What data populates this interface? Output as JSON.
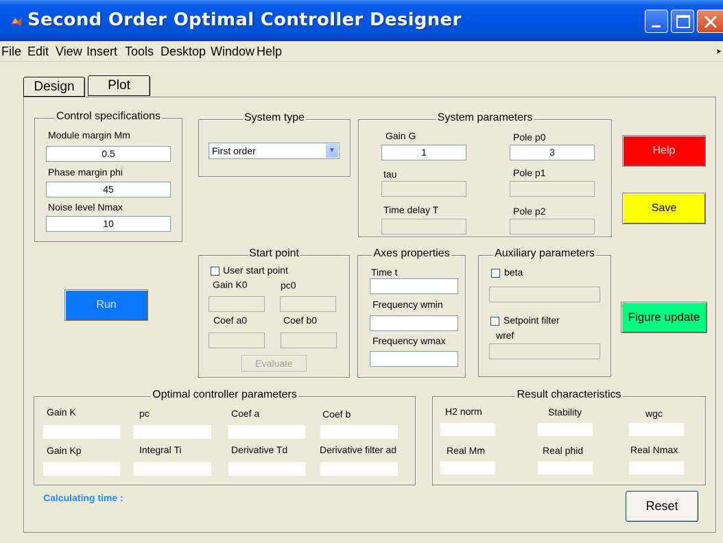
{
  "window": {
    "title": "Second Order Optimal Controller Designer"
  },
  "menu": [
    "File",
    "Edit",
    "View",
    "Insert",
    "Tools",
    "Desktop",
    "Window",
    "Help"
  ],
  "tabs": {
    "design": "Design",
    "plot": "Plot"
  },
  "control_specs": {
    "title": "Control specifications",
    "mm_label": "Module margin Mm",
    "mm_value": "0.5",
    "phi_label": "Phase margin phi",
    "phi_value": "45",
    "nmax_label": "Noise level Nmax",
    "nmax_value": "10"
  },
  "system_type": {
    "title": "System type",
    "selected": "First order"
  },
  "system_params": {
    "title": "System parameters",
    "gain_label": "Gain G",
    "gain_value": "1",
    "p0_label": "Pole p0",
    "p0_value": "3",
    "tau_label": "tau",
    "p1_label": "Pole p1",
    "delay_label": "Time delay T",
    "p2_label": "Pole p2"
  },
  "buttons": {
    "help": "Help",
    "save": "Save",
    "run": "Run",
    "figure_update": "Figure update",
    "evaluate": "Evaluate",
    "reset": "Reset"
  },
  "start_point": {
    "title": "Start point",
    "user_label": "User start point",
    "k0_label": "Gain K0",
    "pc0_label": "pc0",
    "a0_label": "Coef a0",
    "b0_label": "Coef b0"
  },
  "axes": {
    "title": "Axes properties",
    "time_label": "Time t",
    "wmin_label": "Frequency wmin",
    "wmax_label": "Frequency wmax"
  },
  "aux": {
    "title": "Auxiliary parameters",
    "beta_label": "beta",
    "setpoint_label": "Setpoint filter",
    "wref_label": "wref"
  },
  "optimal": {
    "title": "Optimal controller parameters",
    "k": "Gain K",
    "pc": "pc",
    "a": "Coef a",
    "b": "Coef b",
    "kp": "Gain Kp",
    "ti": "Integral Ti",
    "td": "Derivative Td",
    "ad": "Derivative filter ad"
  },
  "results": {
    "title": "Result characteristics",
    "h2": "H2 norm",
    "stability": "Stability",
    "wgc": "wgc",
    "mm": "Real Mm",
    "phid": "Real phid",
    "nmax": "Real Nmax"
  },
  "status": {
    "calc_label": "Calculating time :"
  },
  "colors": {
    "help_bg": "#ff0000",
    "save_bg": "#ffff00",
    "run_bg": "#0a74ff",
    "figure_update_bg": "#00ff7f",
    "calc_text": "#1a8cff",
    "titlebar": "#0054e3"
  }
}
